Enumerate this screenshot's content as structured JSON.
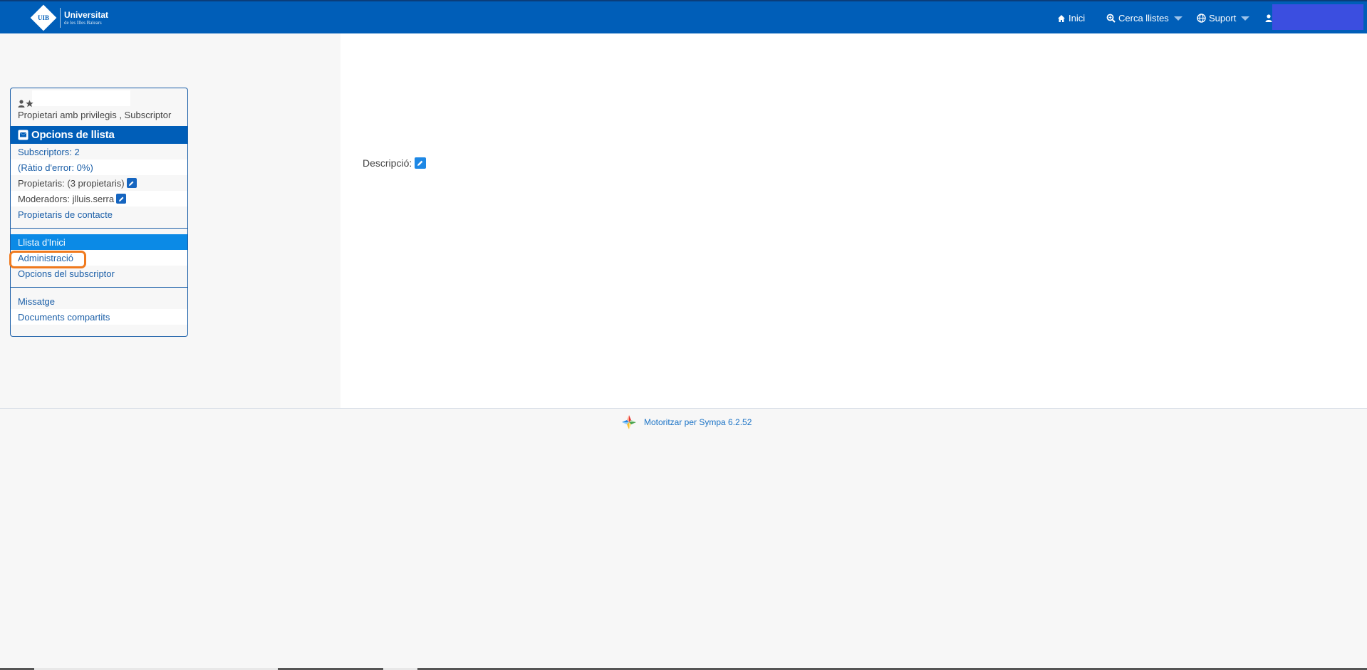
{
  "brand": {
    "logo_badge": "UIB",
    "name_line1": "Universitat",
    "name_line2": "de les Illes Balears"
  },
  "nav": {
    "home_label": "Inici",
    "search_label": "Cerca llistes",
    "support_label": "Suport"
  },
  "sidebar": {
    "role_text": "Propietari amb privilegis , Subscriptor",
    "options_title": "Opcions de llista",
    "stats": [
      "Subscriptors: 2",
      "(Ràtio d'error: 0%)",
      "Propietaris: (3 propietaris)",
      "Moderadors: jlluis.serra",
      "Propietaris de contacte"
    ],
    "menu": [
      "Llista d'Inici",
      "Administració",
      "Opcions del subscriptor"
    ],
    "extra": [
      "Missatge",
      "Documents compartits"
    ]
  },
  "main": {
    "description_label": "Descripció:"
  },
  "footer": {
    "powered_by": "Motoritzar per Sympa 6.2.52"
  },
  "colors": {
    "topbar": "#005eb8",
    "accent": "#0b8ae6",
    "highlight": "#f07a1e"
  }
}
